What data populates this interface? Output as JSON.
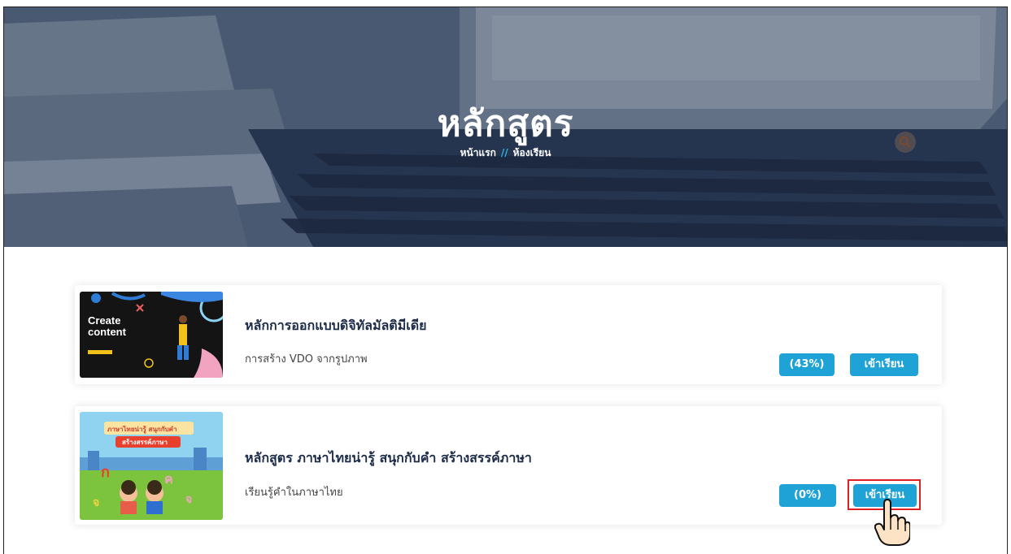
{
  "hero": {
    "title": "หลักสูตร",
    "breadcrumb": {
      "home": "หน้าแรก",
      "separator": "//",
      "current": "ห้องเรียน"
    }
  },
  "courses": [
    {
      "title": "หลักการออกแบบดิจิทัลมัลติมีเดีย",
      "subtitle": "การสร้าง VDO จากรูปภาพ",
      "progress_label": "(43%)",
      "progress": 0.43,
      "enter_label": "เข้าเรียน",
      "thumb_text": [
        "Create",
        "content"
      ]
    },
    {
      "title": "หลักสูตร ภาษาไทยน่ารู้ สนุกกับคำ สร้างสรรค์ภาษา",
      "subtitle": "เรียนรู้คำในภาษาไทย",
      "progress_label": "(0%)",
      "progress": 0,
      "enter_label": "เข้าเรียน",
      "thumb_text": [
        "ภาษาไทยน่ารู้ สนุกกับคำ",
        "สร้างสรรค์ภาษา"
      ]
    }
  ],
  "colors": {
    "accent": "#1fa3d6",
    "highlight": "#e02020",
    "title": "#1c2b47"
  },
  "icons": [
    "search-icon",
    "hand-pointer-icon"
  ]
}
